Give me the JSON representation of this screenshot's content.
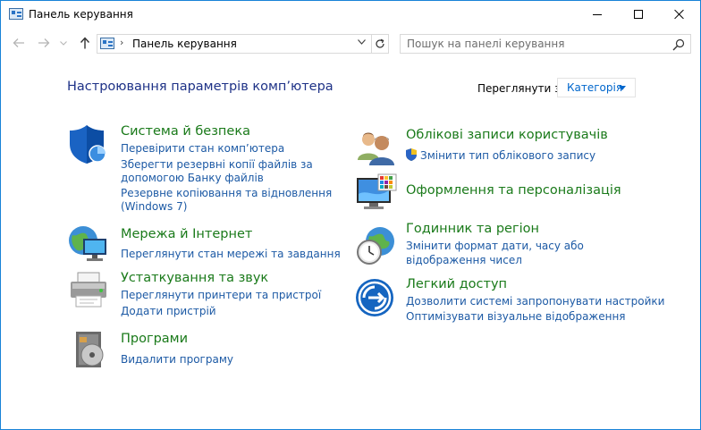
{
  "window": {
    "title": "Панель керування"
  },
  "nav": {
    "address": "Панель керування",
    "search_placeholder": "Пошук на панелі керування"
  },
  "header": {
    "heading": "Настроювання параметрів комп’ютера",
    "view_label": "Переглянути за:",
    "view_value": "Категорія"
  },
  "categories": {
    "system": {
      "title": "Система й безпека",
      "links": [
        "Перевірити стан комп’ютера",
        "Зберегти резервні копії файлів за",
        "допомогою Банку файлів",
        "Резервне копіювання та відновлення",
        "(Windows 7)"
      ]
    },
    "network": {
      "title": "Мережа й Інтернет",
      "links": [
        "Переглянути стан мережі та завдання"
      ]
    },
    "hardware": {
      "title": "Устаткування та звук",
      "links": [
        "Переглянути принтери та пристрої",
        "Додати пристрій"
      ]
    },
    "programs": {
      "title": "Програми",
      "links": [
        "Видалити програму"
      ]
    },
    "accounts": {
      "title": "Облікові записи користувачів",
      "links": [
        "Змінити тип облікового запису"
      ]
    },
    "appearance": {
      "title": "Оформлення та персоналізація"
    },
    "clock": {
      "title": "Годинник та регіон",
      "links": [
        "Змінити формат дати, часу або",
        "відображення чисел"
      ]
    },
    "ease": {
      "title": "Легкий доступ",
      "links": [
        "Дозволити системі запропонувати настройки",
        "Оптимізувати візуальне відображення"
      ]
    }
  },
  "colors": {
    "heading": "#1e3287",
    "category_title": "#1a7a1a",
    "link": "#1d5aa5",
    "window_border": "#1883d7"
  },
  "icons": [
    "control-panel-icon",
    "back-arrow-icon",
    "forward-arrow-icon",
    "up-arrow-icon",
    "refresh-icon",
    "search-icon",
    "shield-icon",
    "globe-network-icon",
    "printer-icon",
    "programs-icon",
    "users-icon",
    "display-icon",
    "clock-globe-icon",
    "ease-of-access-icon"
  ]
}
